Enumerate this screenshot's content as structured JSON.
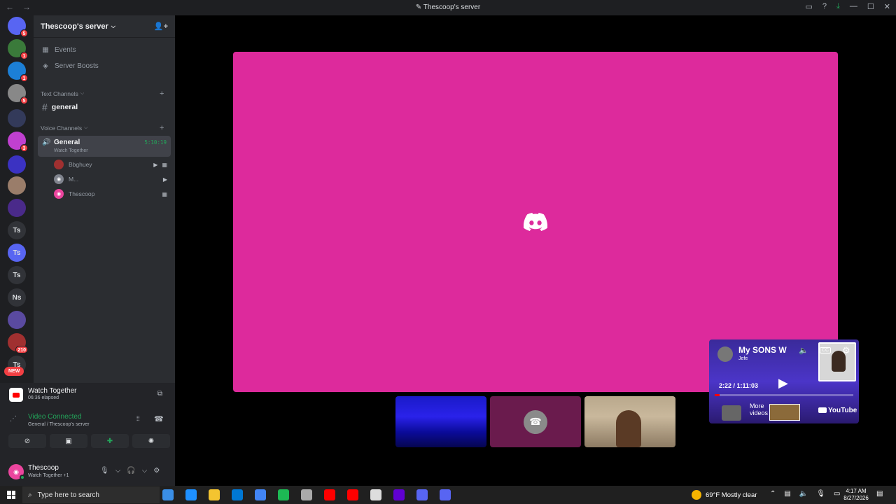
{
  "window": {
    "title": "Thescoop's server"
  },
  "guilds": {
    "items": [
      {
        "name": "discord-home",
        "color": "#5865f2",
        "badge": "5",
        "label": ""
      },
      {
        "name": "server-1",
        "color": "#3a7a3a",
        "badge": "1",
        "label": ""
      },
      {
        "name": "server-2",
        "color": "#1c7fd6",
        "badge": "1",
        "label": ""
      },
      {
        "name": "server-3",
        "color": "#888888",
        "badge": "5",
        "label": ""
      },
      {
        "name": "server-4",
        "color": "#333a5a",
        "badge": "",
        "label": ""
      },
      {
        "name": "server-5",
        "color": "#c040d0",
        "badge": "3",
        "label": ""
      },
      {
        "name": "server-6",
        "color": "#3b32c2",
        "badge": "",
        "label": ""
      },
      {
        "name": "server-7",
        "color": "#9a7d6a",
        "badge": "",
        "label": ""
      },
      {
        "name": "server-8",
        "color": "#4a2a8a",
        "badge": "",
        "label": ""
      },
      {
        "name": "server-ts-1",
        "color": "#313338",
        "badge": "",
        "label": "Ts"
      },
      {
        "name": "server-ts-2",
        "color": "#5865f2",
        "badge": "",
        "label": "Ts"
      },
      {
        "name": "server-ts-3",
        "color": "#313338",
        "badge": "",
        "label": "Ts"
      },
      {
        "name": "server-ns",
        "color": "#313338",
        "badge": "",
        "label": "Ns"
      },
      {
        "name": "server-9",
        "color": "#5a4aa0",
        "badge": "",
        "label": ""
      },
      {
        "name": "server-10",
        "color": "#a03030",
        "badge": "210",
        "label": ""
      },
      {
        "name": "server-ts-4",
        "color": "#313338",
        "badge": "",
        "label": "Ts"
      }
    ],
    "new_label": "NEW"
  },
  "sidebar": {
    "server_name": "Thescoop's server",
    "events": "Events",
    "boosts": "Server Boosts",
    "text_category": "Text Channels",
    "text_channel": "general",
    "voice_category": "Voice Channels",
    "voice_channel": "General",
    "voice_activity": "Watch Together",
    "voice_timer": "5:10:19",
    "members": [
      {
        "name": "Bbghuey",
        "color": "#a03030"
      },
      {
        "name": "M...",
        "color": "#80848e"
      },
      {
        "name": "Thescoop",
        "color": "#eb459e"
      }
    ]
  },
  "activity": {
    "title": "Watch Together",
    "elapsed": "06:36 elapsed"
  },
  "voice_status": {
    "status": "Video Connected",
    "location": "General / Thescoop's server"
  },
  "user": {
    "name": "Thescoop",
    "status": "Watch Together +1"
  },
  "youtube": {
    "title": "My SONS W",
    "channel": "Jefe",
    "time": "2:22 / 1:11:03",
    "progress": 0.033,
    "more": "More",
    "more2": "videos",
    "brand": "YouTube",
    "cc": "CC"
  },
  "taskbar": {
    "search_placeholder": "Type here to search",
    "weather": "69°F  Mostly clear",
    "time": "4:17 AM",
    "date": "8/27/2026",
    "apps": [
      "#3a8ee6",
      "#1e90ff",
      "#f4c430",
      "#0078d4",
      "#4285f4",
      "#1db954",
      "#aaaaaa",
      "#ff0000",
      "#ff0000",
      "#dddddd",
      "#6001d2",
      "#5865f2",
      "#5865f2"
    ]
  }
}
